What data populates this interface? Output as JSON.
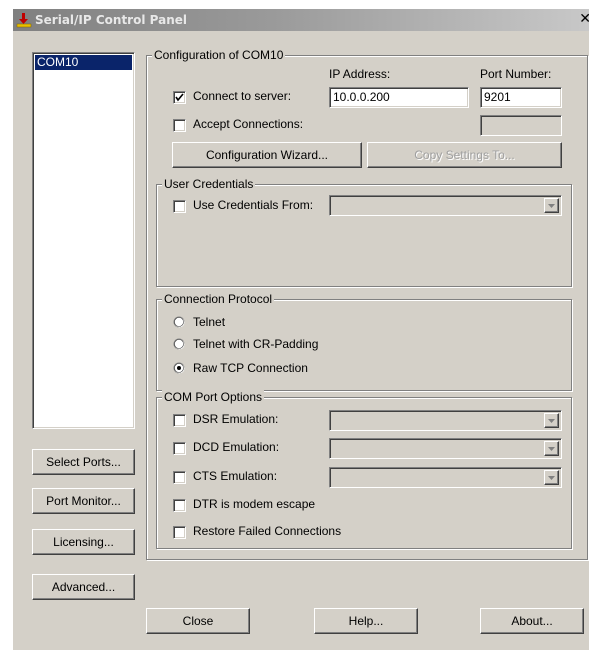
{
  "window": {
    "title": "Serial/IP Control Panel"
  },
  "ports": {
    "items": [
      "COM10"
    ],
    "selected": "COM10"
  },
  "left_buttons": {
    "select_ports": "Select Ports...",
    "port_monitor": "Port Monitor...",
    "licensing": "Licensing...",
    "advanced": "Advanced..."
  },
  "config": {
    "group_label": "Configuration of COM10",
    "ip_address_label": "IP Address:",
    "port_number_label": "Port Number:",
    "connect_to_server_label": "Connect to server:",
    "connect_to_server_checked": true,
    "ip_address_value": "10.0.0.200",
    "port_number_value": "9201",
    "accept_connections_label": "Accept Connections:",
    "accept_connections_checked": false,
    "accept_port_value": "",
    "wizard_button": "Configuration Wizard...",
    "copy_settings_button": "Copy Settings To..."
  },
  "credentials": {
    "group_label": "User Credentials",
    "use_credentials_label": "Use Credentials From:",
    "use_credentials_checked": false,
    "selected_value": ""
  },
  "protocol": {
    "group_label": "Connection Protocol",
    "options": [
      "Telnet",
      "Telnet with CR-Padding",
      "Raw TCP Connection"
    ],
    "selected": "Raw TCP Connection"
  },
  "com_options": {
    "group_label": "COM Port Options",
    "dsr_label": "DSR Emulation:",
    "dcd_label": "DCD Emulation:",
    "cts_label": "CTS Emulation:",
    "dtr_label": "DTR is modem escape",
    "restore_label": "Restore Failed Connections"
  },
  "footer": {
    "close": "Close",
    "help": "Help...",
    "about": "About..."
  },
  "colors": {
    "face": "#d4d0c8",
    "selection": "#0a246a",
    "disabled_text": "#a0a0a0"
  }
}
